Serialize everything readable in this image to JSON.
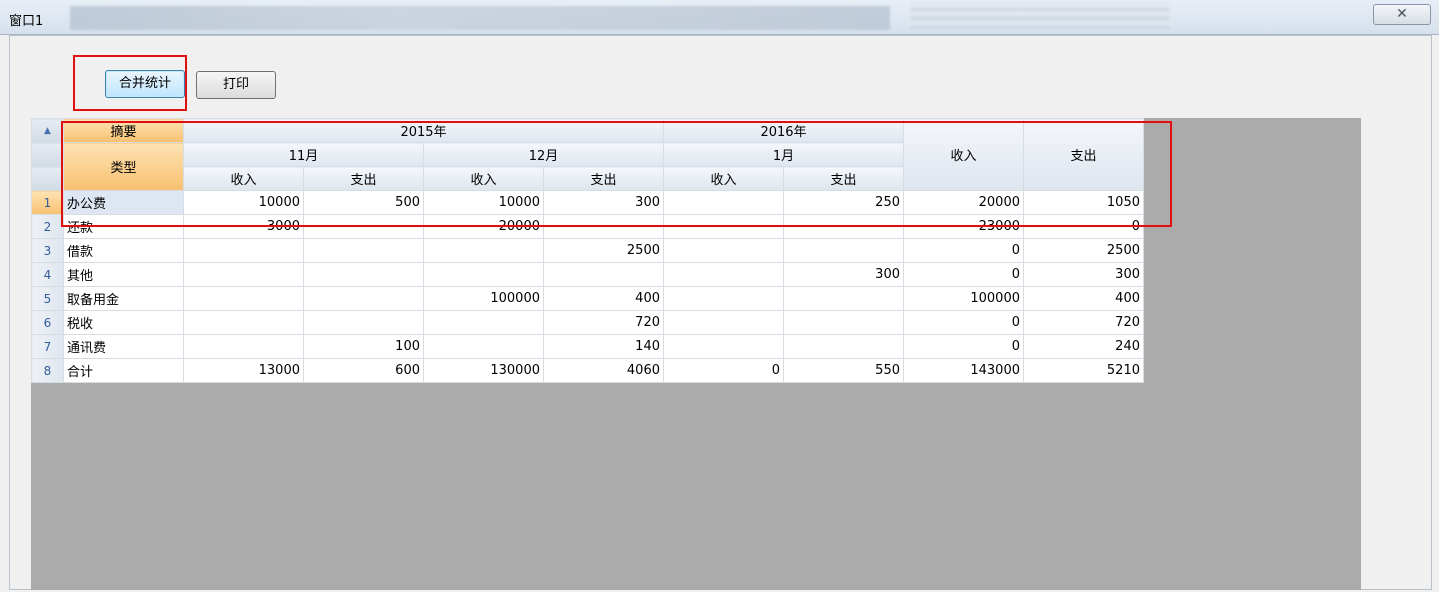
{
  "window": {
    "title": "窗口1",
    "close_glyph": "✕"
  },
  "toolbar": {
    "merge_label": "合并统计",
    "print_label": "打印"
  },
  "grid": {
    "corner_glyph": "▲",
    "header": {
      "zhaiyao": "摘要",
      "leixing": "类型",
      "year2015": "2015年",
      "year2016": "2016年",
      "m11": "11月",
      "m12": "12月",
      "m1": "1月",
      "shouru": "收入",
      "zhichu": "支出",
      "total_shouru": "收入",
      "total_zhichu": "支出"
    },
    "rows": [
      {
        "n": "1",
        "type": "办公费",
        "v": [
          "10000",
          "500",
          "10000",
          "300",
          "",
          "250",
          "20000",
          "1050"
        ]
      },
      {
        "n": "2",
        "type": "还款",
        "v": [
          "3000",
          "",
          "20000",
          "",
          "",
          "",
          "23000",
          "0"
        ]
      },
      {
        "n": "3",
        "type": "借款",
        "v": [
          "",
          "",
          "",
          "2500",
          "",
          "",
          "0",
          "2500"
        ]
      },
      {
        "n": "4",
        "type": "其他",
        "v": [
          "",
          "",
          "",
          "",
          "",
          "300",
          "0",
          "300"
        ]
      },
      {
        "n": "5",
        "type": "取备用金",
        "v": [
          "",
          "",
          "100000",
          "400",
          "",
          "",
          "100000",
          "400"
        ]
      },
      {
        "n": "6",
        "type": "税收",
        "v": [
          "",
          "",
          "",
          "720",
          "",
          "",
          "0",
          "720"
        ]
      },
      {
        "n": "7",
        "type": "通讯费",
        "v": [
          "",
          "100",
          "",
          "140",
          "",
          "",
          "0",
          "240"
        ]
      },
      {
        "n": "8",
        "type": "合计",
        "v": [
          "13000",
          "600",
          "130000",
          "4060",
          "0",
          "550",
          "143000",
          "5210"
        ]
      }
    ]
  }
}
